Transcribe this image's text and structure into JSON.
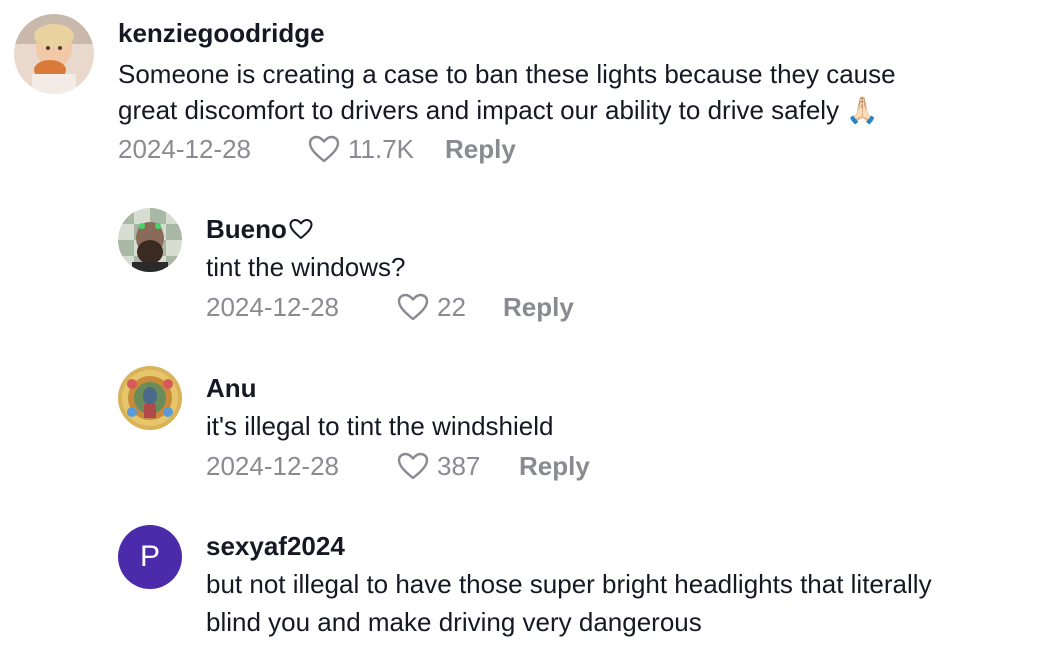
{
  "comments": [
    {
      "username": "kenziegoodridge",
      "text_lines": [
        "Someone is creating a case to ban these lights because they cause",
        "great discomfort to drivers and impact our ability to drive safely 🙏🏻"
      ],
      "date": "2024-12-28",
      "likes": "11.7K",
      "reply_label": "Reply"
    },
    {
      "username": "Bueno",
      "text_lines": [
        "tint the windows?"
      ],
      "date": "2024-12-28",
      "likes": "22",
      "reply_label": "Reply"
    },
    {
      "username": "Anu",
      "text_lines": [
        "it's illegal to tint the windshield"
      ],
      "date": "2024-12-28",
      "likes": "387",
      "reply_label": "Reply"
    },
    {
      "username": "sexyaf2024",
      "avatar_letter": "P",
      "text_lines": [
        "but not illegal to have those super bright headlights that literally",
        "blind you and make driving very dangerous"
      ]
    }
  ],
  "colors": {
    "text": "#161823",
    "meta": "#8a8b91",
    "letter_avatar_bg": "#4c2bab"
  }
}
